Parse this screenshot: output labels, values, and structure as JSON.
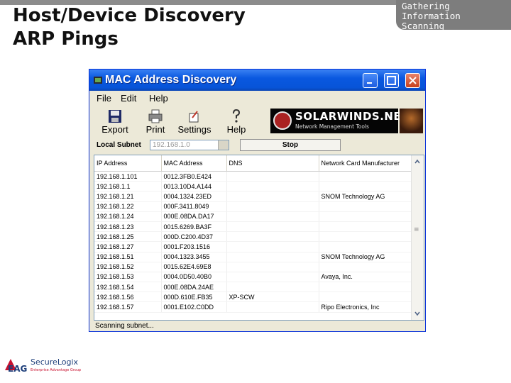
{
  "slide": {
    "title_line1": "Host/Device Discovery",
    "title_line2": "ARP Pings",
    "section_tab": "Gathering Information\nScanning"
  },
  "window": {
    "title": "MAC Address Discovery",
    "menu": [
      "File",
      "Edit",
      "Help"
    ],
    "toolbar": [
      "Export",
      "Print",
      "Settings",
      "Help"
    ],
    "brand": "SOLARWINDS.NET",
    "brand_tagline": "Network Management Tools",
    "subnet_label": "Local Subnet",
    "subnet_value": "192.168.1.0",
    "stop_label": "Stop",
    "status": "Scanning subnet..."
  },
  "table": {
    "columns": [
      "IP Address",
      "MAC Address",
      "DNS",
      "Network Card Manufacturer"
    ],
    "rows": [
      [
        "192.168.1.101",
        "0012.3FB0.E424",
        "",
        ""
      ],
      [
        "192.168.1.1",
        "0013.10D4.A144",
        "",
        ""
      ],
      [
        "192.168.1.21",
        "0004.1324.23ED",
        "",
        "SNOM Technology AG"
      ],
      [
        "192.168.1.22",
        "000F.3411.8049",
        "",
        ""
      ],
      [
        "192.168.1.24",
        "000E.08DA.DA17",
        "",
        ""
      ],
      [
        "192.168.1.23",
        "0015.6269.BA3F",
        "",
        ""
      ],
      [
        "192.168.1.25",
        "000D.C200.4D37",
        "",
        ""
      ],
      [
        "192.168.1.27",
        "0001.F203.1516",
        "",
        ""
      ],
      [
        "192.168.1.51",
        "0004.1323.3455",
        "",
        "SNOM Technology AG"
      ],
      [
        "192.168.1.52",
        "0015.62E4.69E8",
        "",
        ""
      ],
      [
        "192.168.1.53",
        "0004.0D50.40B0",
        "",
        "Avaya, Inc."
      ],
      [
        "192.168.1.54",
        "000E.08DA.24AE",
        "",
        ""
      ],
      [
        "192.168.1.56",
        "000D.610E.FB35",
        "XP-SCW",
        ""
      ],
      [
        "192.168.1.57",
        "0001.E102.C0DD",
        "",
        "Ripo Electronics, Inc"
      ]
    ]
  },
  "footer": {
    "logo_brand": "SecureLogix",
    "logo_mark": "EAG",
    "logo_tagline": "Enterprise Advantage Group"
  },
  "colors": {
    "titlebar": "#0a58e0",
    "tab": "#7d7d7d"
  }
}
